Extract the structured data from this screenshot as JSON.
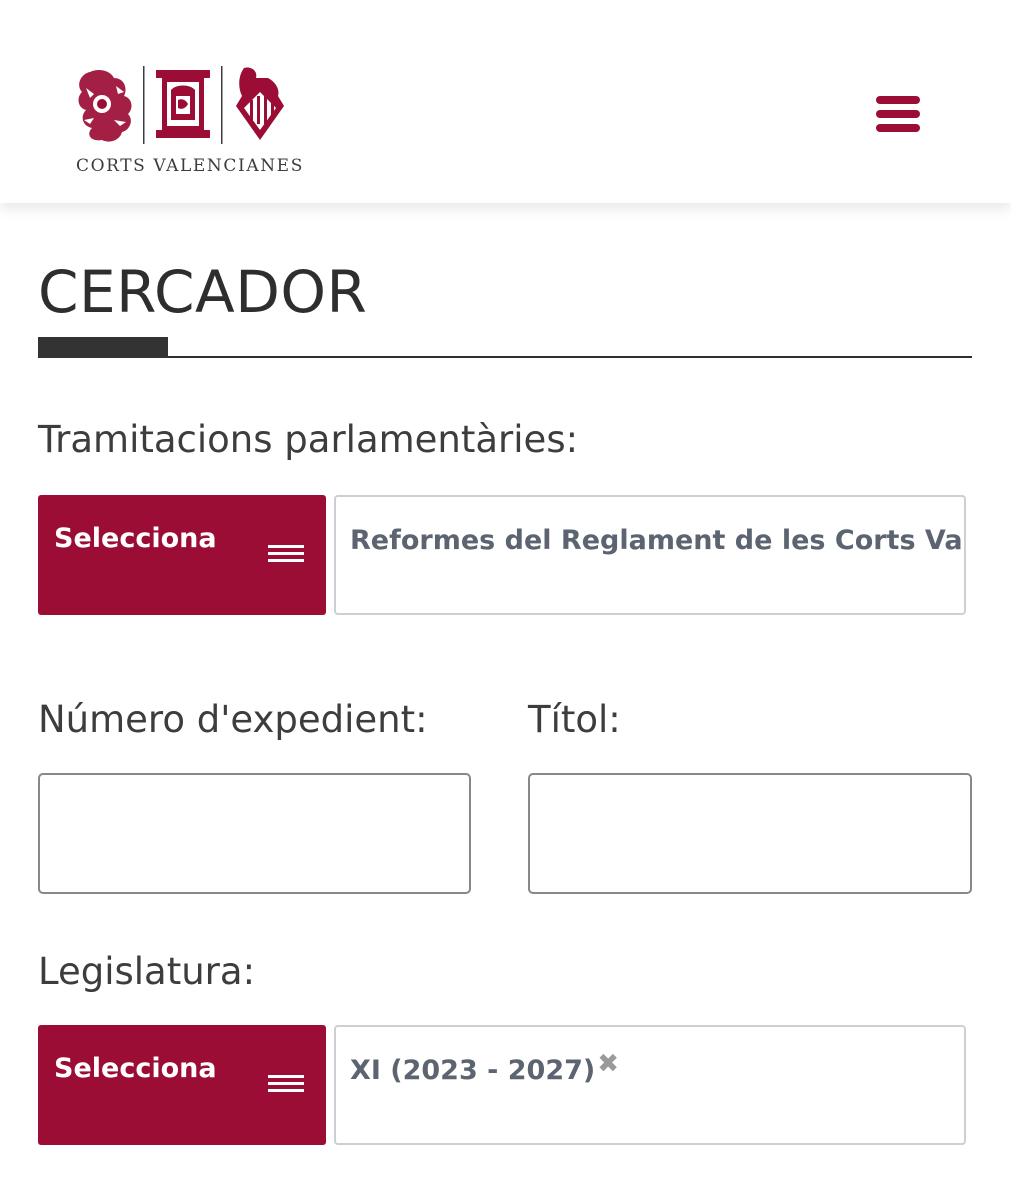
{
  "header": {
    "logo_text": "CORTS VALENCIANES",
    "menu_icon": "hamburger-menu-icon",
    "brand_color": "#9b0d34"
  },
  "page": {
    "title": "CERCADOR"
  },
  "form": {
    "tramitacions": {
      "label": "Tramitacions parlamentàries:",
      "button_label": "Selecciona",
      "selected_value": "Reformes del Reglament de les Corts Valencianes"
    },
    "numero_expedient": {
      "label": "Número d'expedient:",
      "value": ""
    },
    "titol": {
      "label": "Títol:",
      "value": ""
    },
    "legislatura": {
      "label": "Legislatura:",
      "button_label": "Selecciona",
      "selected_value": "XI (2023 - 2027)",
      "remove_glyph": "✖"
    }
  }
}
